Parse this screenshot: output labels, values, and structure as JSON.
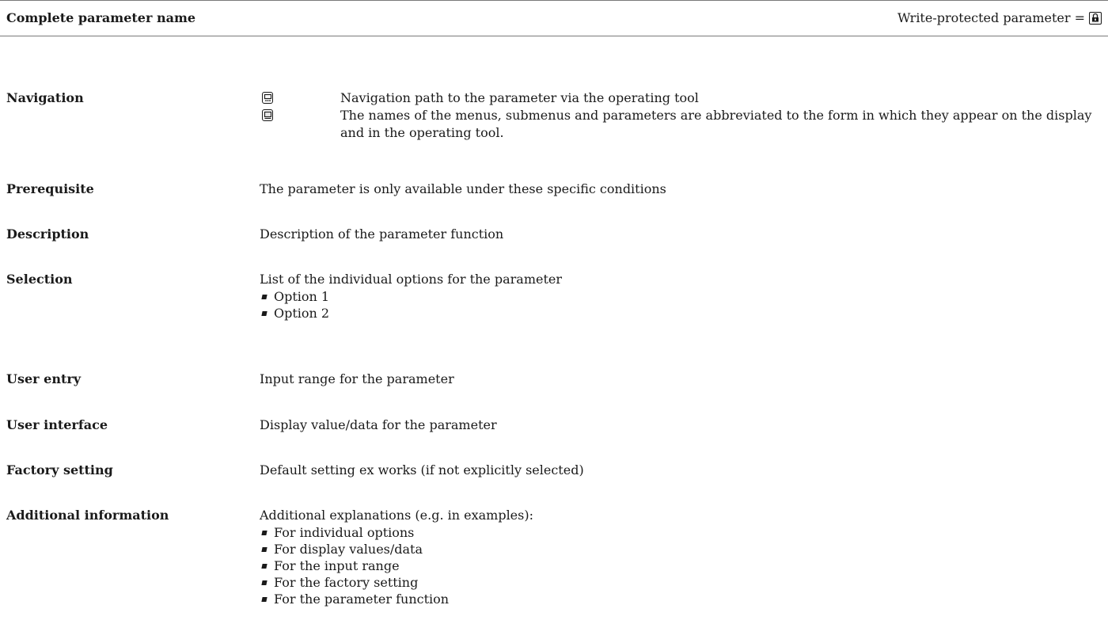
{
  "header": {
    "title": "Complete parameter name",
    "write_protected_label": "Write-protected parameter ="
  },
  "icons": {
    "write_protected": "lock-icon",
    "operating_tool": "operating-tool-icon",
    "display": "display-icon"
  },
  "rows": {
    "navigation": {
      "label": "Navigation",
      "line1": "Navigation path to the parameter via the operating tool",
      "line2": "The names of the menus, submenus and parameters are abbreviated to the form in which they appear on the display and in the operating tool."
    },
    "prerequisite": {
      "label": "Prerequisite",
      "text": "The parameter is only available under these specific conditions"
    },
    "description": {
      "label": "Description",
      "text": "Description of the parameter function"
    },
    "selection": {
      "label": "Selection",
      "text": "List of the individual options for the parameter",
      "options": [
        "Option 1",
        "Option 2"
      ]
    },
    "user_entry": {
      "label": "User entry",
      "text": "Input range for the parameter"
    },
    "user_interface": {
      "label": "User interface",
      "text": "Display value/data for the parameter"
    },
    "factory_setting": {
      "label": "Factory setting",
      "text": "Default setting ex works (if not explicitly selected)"
    },
    "additional_information": {
      "label": "Additional information",
      "text": "Additional explanations (e.g. in examples):",
      "items": [
        "For individual options",
        "For display values/data",
        "For the input range",
        "For the factory setting",
        "For the parameter function"
      ]
    }
  }
}
